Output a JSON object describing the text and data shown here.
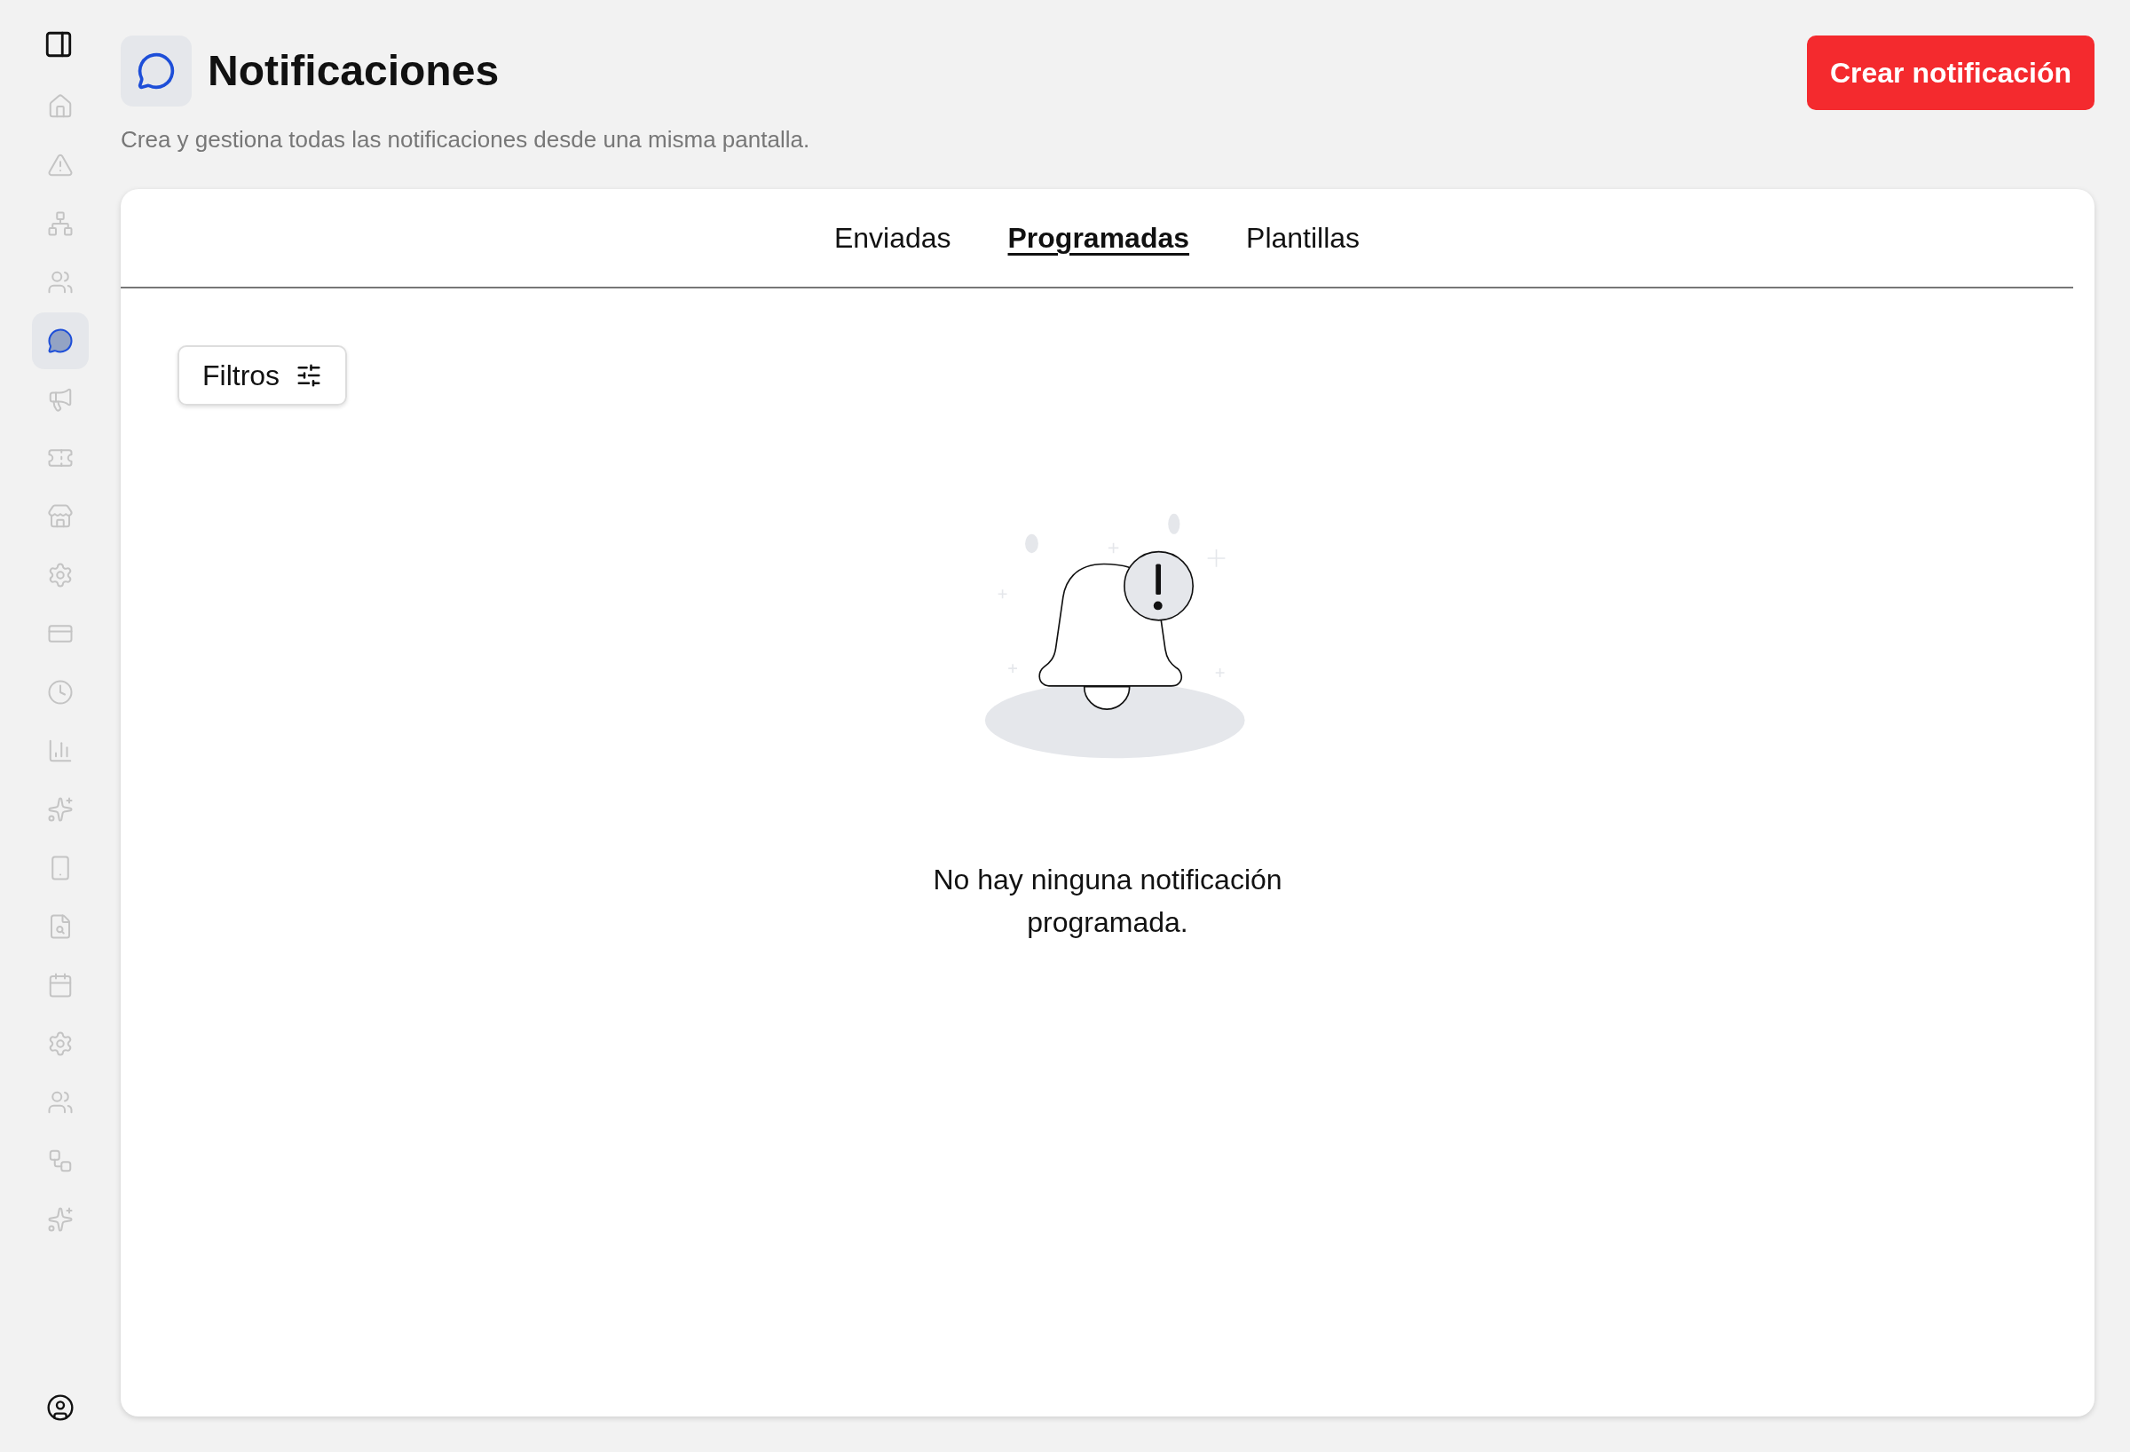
{
  "sidebar": {
    "items": [
      {
        "selected": false
      },
      {
        "selected": false
      },
      {
        "selected": false
      },
      {
        "selected": false
      },
      {
        "selected": true
      },
      {
        "selected": false
      },
      {
        "selected": false
      },
      {
        "selected": false
      },
      {
        "selected": false
      },
      {
        "selected": false
      },
      {
        "selected": false
      },
      {
        "selected": false
      },
      {
        "selected": false
      },
      {
        "selected": false
      },
      {
        "selected": false
      },
      {
        "selected": false
      },
      {
        "selected": false
      },
      {
        "selected": false
      },
      {
        "selected": false
      },
      {
        "selected": false
      }
    ]
  },
  "header": {
    "title": "Notificaciones",
    "subtitle": "Crea y gestiona todas las notificaciones desde una misma pantalla.",
    "primary_button": "Crear notificación"
  },
  "tabs": [
    {
      "label": "Enviadas",
      "selected": false
    },
    {
      "label": "Programadas",
      "selected": true
    },
    {
      "label": "Plantillas",
      "selected": false
    }
  ],
  "filters_button": "Filtros",
  "empty_state": {
    "message": "No hay ninguna notificación programada."
  }
}
